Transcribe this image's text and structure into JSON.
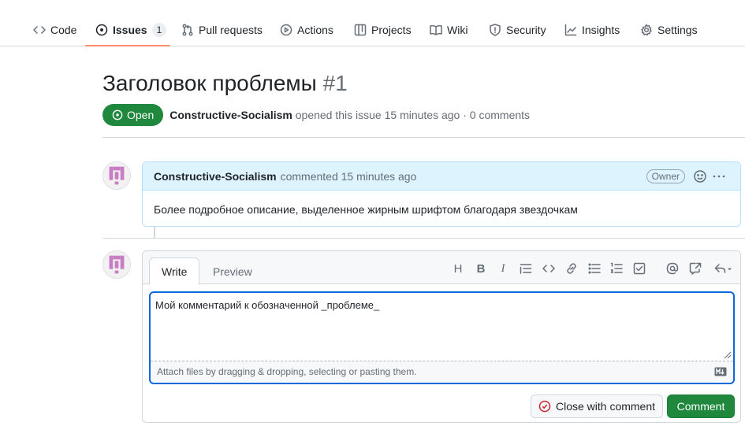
{
  "nav": {
    "tabs": [
      {
        "label": "Code",
        "icon": "code-icon"
      },
      {
        "label": "Issues",
        "icon": "issue-opened-icon",
        "count": "1",
        "active": true
      },
      {
        "label": "Pull requests",
        "icon": "git-pull-request-icon"
      },
      {
        "label": "Actions",
        "icon": "play-icon"
      },
      {
        "label": "Projects",
        "icon": "table-icon"
      },
      {
        "label": "Wiki",
        "icon": "book-icon"
      },
      {
        "label": "Security",
        "icon": "shield-icon"
      },
      {
        "label": "Insights",
        "icon": "graph-icon"
      },
      {
        "label": "Settings",
        "icon": "gear-icon"
      }
    ]
  },
  "issue": {
    "title": "Заголовок проблемы",
    "number": "#1",
    "state": "Open",
    "author": "Constructive-Socialism",
    "opened_text": "opened this issue 15 minutes ago · 0 comments"
  },
  "comment": {
    "author": "Constructive-Socialism",
    "when": "commented 15 minutes ago",
    "role_badge": "Owner",
    "body": "Более подробное описание, выделенное жирным шрифтом благодаря звездочкам"
  },
  "editor": {
    "tabs": [
      "Write",
      "Preview"
    ],
    "active_tab": "Write",
    "text": "Мой комментарий к обозначенной _проблеме_",
    "attach_hint": "Attach files by dragging & dropping, selecting or pasting them.",
    "toolbar": [
      "heading",
      "bold",
      "italic",
      "quote",
      "code",
      "link",
      "unordered-list",
      "ordered-list",
      "task-list",
      "mention",
      "cross-reference",
      "reply"
    ],
    "close_label": "Close with comment",
    "submit_label": "Comment"
  },
  "colors": {
    "accent_green": "#1f883d",
    "tab_underline": "#fd8c73",
    "comment_header": "#ddf4ff",
    "focus_blue": "#0969da"
  }
}
